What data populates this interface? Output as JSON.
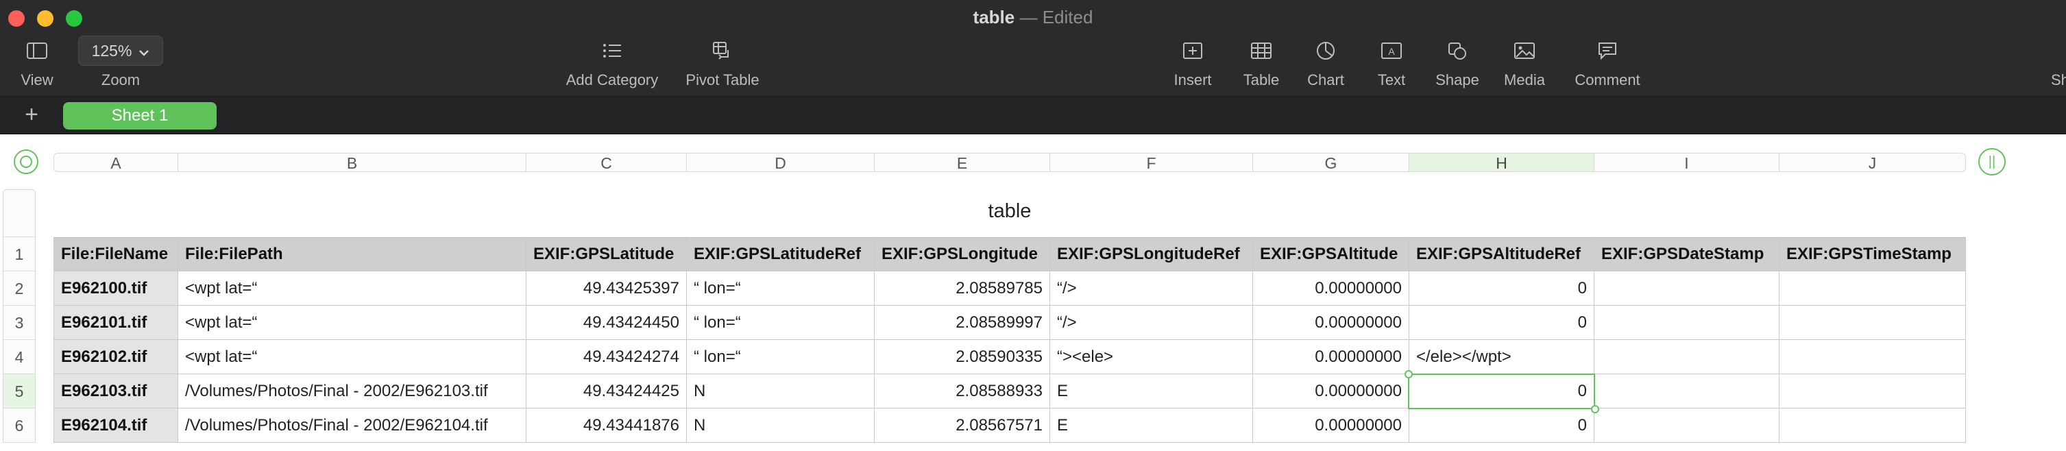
{
  "window": {
    "doc_name": "table",
    "separator": "—",
    "status": "Edited"
  },
  "toolbar": {
    "left": [
      {
        "id": "view",
        "label": "View",
        "icon": "sidebar-icon"
      },
      {
        "id": "zoom",
        "label": "Zoom",
        "value": "125%",
        "icon": "chevron-down-icon"
      }
    ],
    "middle": [
      {
        "id": "add-category",
        "label": "Add Category",
        "icon": "list-icon"
      },
      {
        "id": "pivot-table",
        "label": "Pivot Table",
        "icon": "pivot-table-icon"
      }
    ],
    "right": [
      {
        "id": "insert",
        "label": "Insert",
        "icon": "plus-square-icon"
      },
      {
        "id": "table",
        "label": "Table",
        "icon": "table-icon"
      },
      {
        "id": "chart",
        "label": "Chart",
        "icon": "chart-icon"
      },
      {
        "id": "text",
        "label": "Text",
        "icon": "text-box-icon"
      },
      {
        "id": "shape",
        "label": "Shape",
        "icon": "shape-icon"
      },
      {
        "id": "media",
        "label": "Media",
        "icon": "media-icon"
      },
      {
        "id": "comment",
        "label": "Comment",
        "icon": "comment-icon"
      }
    ],
    "cut_off_label": "Sh"
  },
  "sheets": {
    "add_label": "+",
    "tabs": [
      {
        "label": "Sheet 1",
        "active": true
      }
    ]
  },
  "grid": {
    "column_letters": [
      "A",
      "B",
      "C",
      "D",
      "E",
      "F",
      "G",
      "H",
      "I",
      "J"
    ],
    "active_column": "H",
    "row_numbers": [
      "1",
      "2",
      "3",
      "4",
      "5",
      "6"
    ],
    "active_row": "5"
  },
  "table": {
    "title": "table",
    "headers": [
      "File:FileName",
      "File:FilePath",
      "EXIF:GPSLatitude",
      "EXIF:GPSLatitudeRef",
      "EXIF:GPSLongitude",
      "EXIF:GPSLongitudeRef",
      "EXIF:GPSAltitude",
      "EXIF:GPSAltitudeRef",
      "EXIF:GPSDateStamp",
      "EXIF:GPSTimeStamp"
    ],
    "rows": [
      [
        "E962100.tif",
        "<wpt lat=“",
        "49.43425397",
        "“ lon=“",
        "2.08589785",
        "“/>",
        "0.00000000",
        "0",
        "",
        ""
      ],
      [
        "E962101.tif",
        "<wpt lat=“",
        "49.43424450",
        "“ lon=“",
        "2.08589997",
        "“/>",
        "0.00000000",
        "0",
        "",
        ""
      ],
      [
        "E962102.tif",
        "<wpt lat=“",
        "49.43424274",
        "“ lon=“",
        "2.08590335",
        "“><ele>",
        "0.00000000",
        "</ele></wpt>",
        "",
        ""
      ],
      [
        "E962103.tif",
        "/Volumes/Photos/Final - 2002/E962103.tif",
        "49.43424425",
        "N",
        "2.08588933",
        "E",
        "0.00000000",
        "0",
        "",
        ""
      ],
      [
        "E962104.tif",
        "/Volumes/Photos/Final - 2002/E962104.tif",
        "49.43441876",
        "N",
        "2.08567571",
        "E",
        "0.00000000",
        "0",
        "",
        ""
      ]
    ],
    "selected_cell": {
      "row": 4,
      "col": "H",
      "value": "0"
    }
  }
}
